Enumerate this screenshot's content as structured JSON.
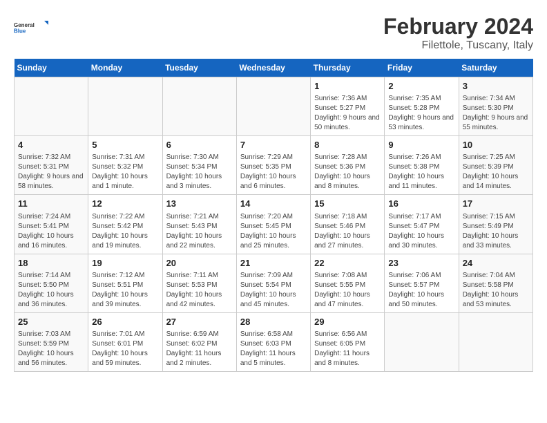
{
  "logo": {
    "general": "General",
    "blue": "Blue"
  },
  "title": "February 2024",
  "subtitle": "Filettole, Tuscany, Italy",
  "headers": [
    "Sunday",
    "Monday",
    "Tuesday",
    "Wednesday",
    "Thursday",
    "Friday",
    "Saturday"
  ],
  "weeks": [
    [
      {
        "day": "",
        "info": ""
      },
      {
        "day": "",
        "info": ""
      },
      {
        "day": "",
        "info": ""
      },
      {
        "day": "",
        "info": ""
      },
      {
        "day": "1",
        "info": "Sunrise: 7:36 AM\nSunset: 5:27 PM\nDaylight: 9 hours and 50 minutes."
      },
      {
        "day": "2",
        "info": "Sunrise: 7:35 AM\nSunset: 5:28 PM\nDaylight: 9 hours and 53 minutes."
      },
      {
        "day": "3",
        "info": "Sunrise: 7:34 AM\nSunset: 5:30 PM\nDaylight: 9 hours and 55 minutes."
      }
    ],
    [
      {
        "day": "4",
        "info": "Sunrise: 7:32 AM\nSunset: 5:31 PM\nDaylight: 9 hours and 58 minutes."
      },
      {
        "day": "5",
        "info": "Sunrise: 7:31 AM\nSunset: 5:32 PM\nDaylight: 10 hours and 1 minute."
      },
      {
        "day": "6",
        "info": "Sunrise: 7:30 AM\nSunset: 5:34 PM\nDaylight: 10 hours and 3 minutes."
      },
      {
        "day": "7",
        "info": "Sunrise: 7:29 AM\nSunset: 5:35 PM\nDaylight: 10 hours and 6 minutes."
      },
      {
        "day": "8",
        "info": "Sunrise: 7:28 AM\nSunset: 5:36 PM\nDaylight: 10 hours and 8 minutes."
      },
      {
        "day": "9",
        "info": "Sunrise: 7:26 AM\nSunset: 5:38 PM\nDaylight: 10 hours and 11 minutes."
      },
      {
        "day": "10",
        "info": "Sunrise: 7:25 AM\nSunset: 5:39 PM\nDaylight: 10 hours and 14 minutes."
      }
    ],
    [
      {
        "day": "11",
        "info": "Sunrise: 7:24 AM\nSunset: 5:41 PM\nDaylight: 10 hours and 16 minutes."
      },
      {
        "day": "12",
        "info": "Sunrise: 7:22 AM\nSunset: 5:42 PM\nDaylight: 10 hours and 19 minutes."
      },
      {
        "day": "13",
        "info": "Sunrise: 7:21 AM\nSunset: 5:43 PM\nDaylight: 10 hours and 22 minutes."
      },
      {
        "day": "14",
        "info": "Sunrise: 7:20 AM\nSunset: 5:45 PM\nDaylight: 10 hours and 25 minutes."
      },
      {
        "day": "15",
        "info": "Sunrise: 7:18 AM\nSunset: 5:46 PM\nDaylight: 10 hours and 27 minutes."
      },
      {
        "day": "16",
        "info": "Sunrise: 7:17 AM\nSunset: 5:47 PM\nDaylight: 10 hours and 30 minutes."
      },
      {
        "day": "17",
        "info": "Sunrise: 7:15 AM\nSunset: 5:49 PM\nDaylight: 10 hours and 33 minutes."
      }
    ],
    [
      {
        "day": "18",
        "info": "Sunrise: 7:14 AM\nSunset: 5:50 PM\nDaylight: 10 hours and 36 minutes."
      },
      {
        "day": "19",
        "info": "Sunrise: 7:12 AM\nSunset: 5:51 PM\nDaylight: 10 hours and 39 minutes."
      },
      {
        "day": "20",
        "info": "Sunrise: 7:11 AM\nSunset: 5:53 PM\nDaylight: 10 hours and 42 minutes."
      },
      {
        "day": "21",
        "info": "Sunrise: 7:09 AM\nSunset: 5:54 PM\nDaylight: 10 hours and 45 minutes."
      },
      {
        "day": "22",
        "info": "Sunrise: 7:08 AM\nSunset: 5:55 PM\nDaylight: 10 hours and 47 minutes."
      },
      {
        "day": "23",
        "info": "Sunrise: 7:06 AM\nSunset: 5:57 PM\nDaylight: 10 hours and 50 minutes."
      },
      {
        "day": "24",
        "info": "Sunrise: 7:04 AM\nSunset: 5:58 PM\nDaylight: 10 hours and 53 minutes."
      }
    ],
    [
      {
        "day": "25",
        "info": "Sunrise: 7:03 AM\nSunset: 5:59 PM\nDaylight: 10 hours and 56 minutes."
      },
      {
        "day": "26",
        "info": "Sunrise: 7:01 AM\nSunset: 6:01 PM\nDaylight: 10 hours and 59 minutes."
      },
      {
        "day": "27",
        "info": "Sunrise: 6:59 AM\nSunset: 6:02 PM\nDaylight: 11 hours and 2 minutes."
      },
      {
        "day": "28",
        "info": "Sunrise: 6:58 AM\nSunset: 6:03 PM\nDaylight: 11 hours and 5 minutes."
      },
      {
        "day": "29",
        "info": "Sunrise: 6:56 AM\nSunset: 6:05 PM\nDaylight: 11 hours and 8 minutes."
      },
      {
        "day": "",
        "info": ""
      },
      {
        "day": "",
        "info": ""
      }
    ]
  ]
}
